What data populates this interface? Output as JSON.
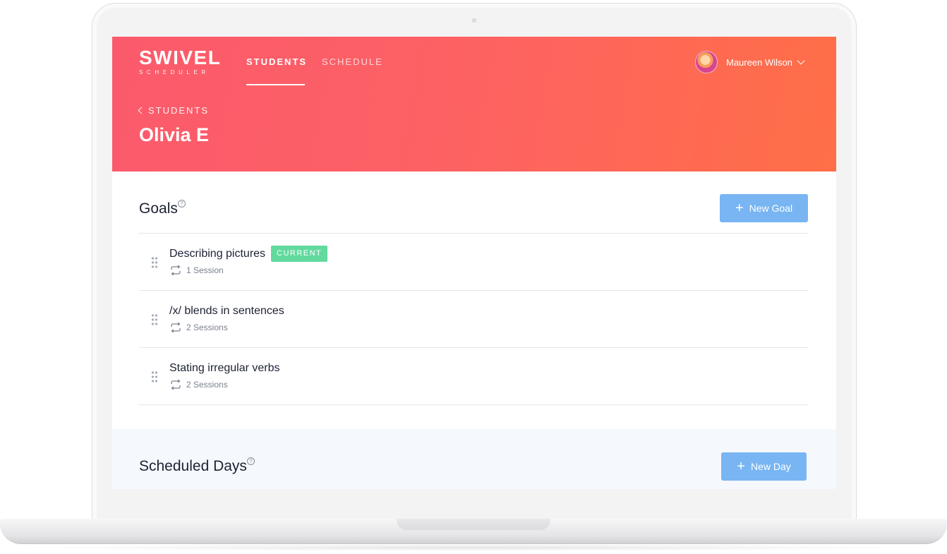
{
  "logo": {
    "main": "SWIVEL",
    "sub": "SCHEDULER"
  },
  "nav": {
    "tabs": [
      {
        "label": "STUDENTS",
        "active": true
      },
      {
        "label": "SCHEDULE",
        "active": false
      }
    ]
  },
  "user": {
    "name": "Maureen Wilson"
  },
  "breadcrumb": {
    "label": "STUDENTS"
  },
  "page_title": "Olivia E",
  "goals": {
    "title": "Goals",
    "help": "?",
    "new_button": "New Goal",
    "items": [
      {
        "title": "Describing pictures",
        "badge": "CURRENT",
        "sessions": "1 Session"
      },
      {
        "title": "/x/ blends in sentences",
        "sessions": "2 Sessions"
      },
      {
        "title": "Stating irregular verbs",
        "sessions": "2 Sessions"
      }
    ]
  },
  "scheduled_days": {
    "title": "Scheduled Days",
    "help": "?",
    "new_button": "New Day"
  },
  "colors": {
    "hero_start": "#fb5a6c",
    "hero_end": "#ff6f47",
    "button": "#78b5f2",
    "badge": "#62d99d"
  }
}
